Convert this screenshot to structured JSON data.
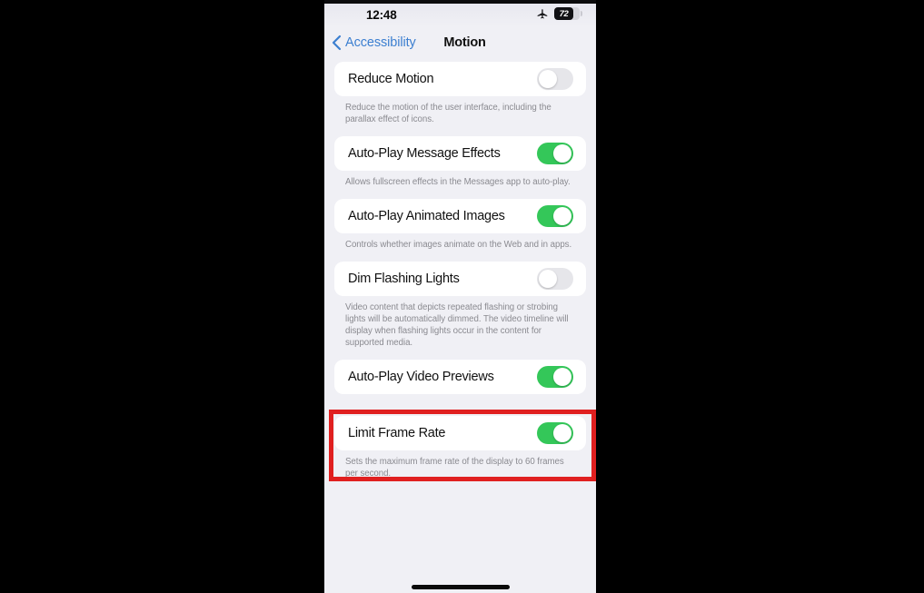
{
  "statusbar": {
    "time": "12:48",
    "airplane_icon": "airplane-mode-icon",
    "battery_level": "72"
  },
  "navbar": {
    "back_label": "Accessibility",
    "back_icon": "chevron-left-icon",
    "title": "Motion"
  },
  "settings": [
    {
      "label": "Reduce Motion",
      "state": "off",
      "description": "Reduce the motion of the user interface, including the parallax effect of icons."
    },
    {
      "label": "Auto-Play Message Effects",
      "state": "on",
      "description": "Allows fullscreen effects in the Messages app to auto-play."
    },
    {
      "label": "Auto-Play Animated Images",
      "state": "on",
      "description": "Controls whether images animate on the Web and in apps."
    },
    {
      "label": "Dim Flashing Lights",
      "state": "off",
      "description": "Video content that depicts repeated flashing or strobing lights will be automatically dimmed. The video timeline will display when flashing lights occur in the content for supported media."
    },
    {
      "label": "Auto-Play Video Previews",
      "state": "on",
      "description": ""
    },
    {
      "label": "Limit Frame Rate",
      "state": "on",
      "description": "Sets the maximum frame rate of the display to 60 frames per second."
    }
  ],
  "colors": {
    "accent_blue": "#3C7FD0",
    "toggle_on_green": "#34C759",
    "toggle_off_gray": "#E6E6EA",
    "highlight_red": "#E02020",
    "background": "#F0F0F5"
  }
}
